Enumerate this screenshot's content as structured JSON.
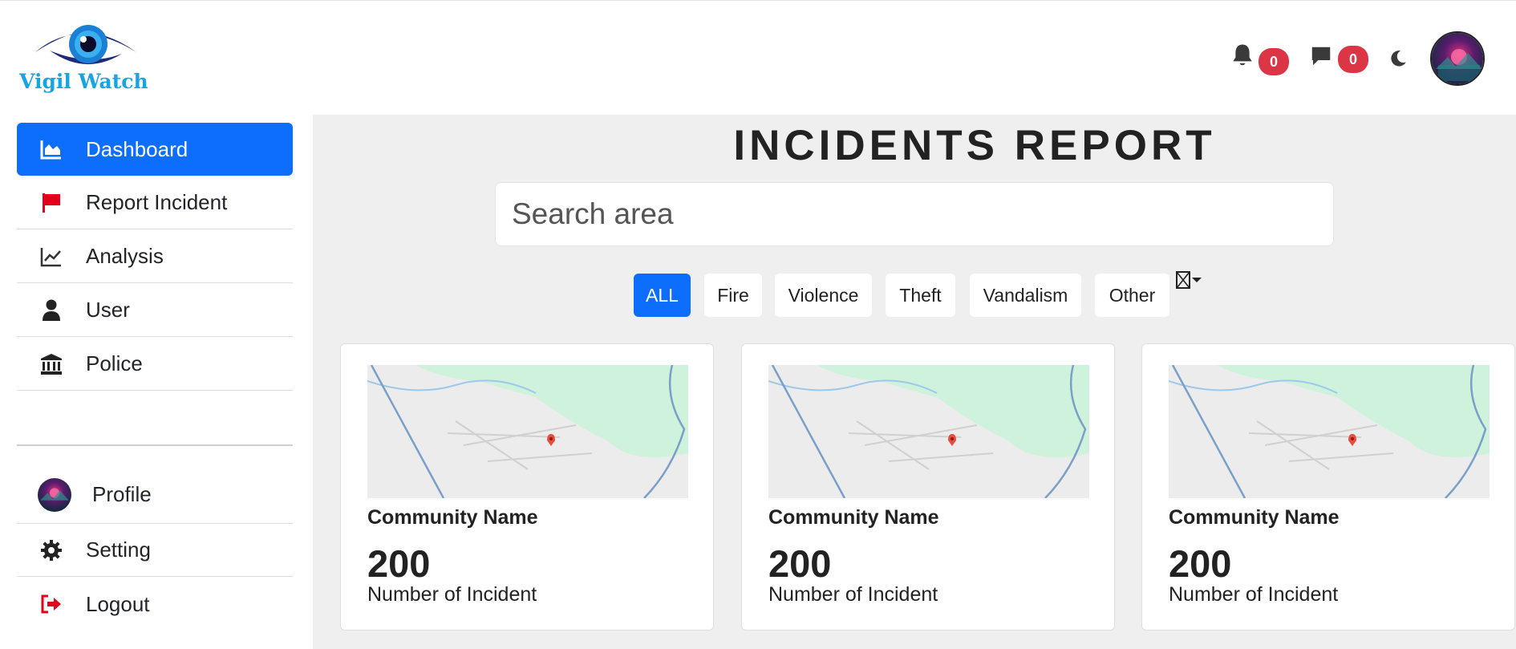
{
  "app": {
    "logo_text": "Vigil Watch"
  },
  "header": {
    "notifications_count": "0",
    "messages_count": "0",
    "theme_icon": "moon-icon",
    "avatar": "user-avatar"
  },
  "sidebar": {
    "items": [
      {
        "label": "Dashboard",
        "icon": "chart-area-icon",
        "active": true
      },
      {
        "label": "Report Incident",
        "icon": "flag-icon"
      },
      {
        "label": "Analysis",
        "icon": "line-chart-icon"
      },
      {
        "label": "User",
        "icon": "user-icon"
      },
      {
        "label": "Police",
        "icon": "building-columns-icon"
      }
    ],
    "bottom_items": [
      {
        "label": "Profile",
        "icon": "avatar"
      },
      {
        "label": "Setting",
        "icon": "gear-icon"
      },
      {
        "label": "Logout",
        "icon": "logout-icon"
      }
    ]
  },
  "main": {
    "title": "INCIDENTS REPORT",
    "search": {
      "placeholder": "Search area",
      "value": ""
    },
    "filters": [
      "ALL",
      "Fire",
      "Violence",
      "Theft",
      "Vandalism",
      "Other"
    ],
    "active_filter": "ALL",
    "cards": [
      {
        "name": "Community Name",
        "count": "200",
        "caption": "Number of Incident"
      },
      {
        "name": "Community Name",
        "count": "200",
        "caption": "Number of Incident"
      },
      {
        "name": "Community Name",
        "count": "200",
        "caption": "Number of Incident"
      }
    ]
  },
  "colors": {
    "primary": "#0d6efd",
    "badge": "#dc3545",
    "danger_icon": "#e3001b",
    "main_bg": "#efefef",
    "map_green": "#cff2dc"
  }
}
